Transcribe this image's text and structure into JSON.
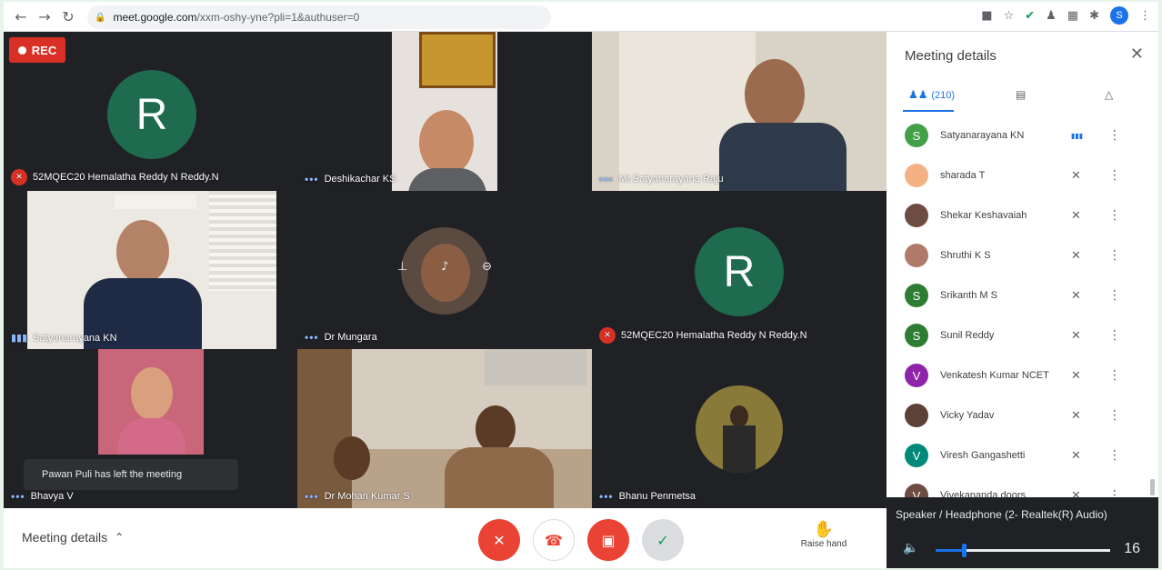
{
  "browser": {
    "url_host": "meet.google.com",
    "url_path": "/xxm-oshy-yne?pli=1&authuser=0",
    "profile_initial": "S"
  },
  "recording": {
    "label": "REC"
  },
  "tiles": [
    {
      "name": "52MQEC20 Hemalatha Reddy N Reddy.N",
      "avatar_letter": "R"
    },
    {
      "name": "Deshikachar KS"
    },
    {
      "name": "Mr.Satyanarayana Raju"
    },
    {
      "name": "Satyanarayana KN"
    },
    {
      "name": "Dr Mungara"
    },
    {
      "name": "52MQEC20 Hemalatha Reddy N Reddy.N",
      "avatar_letter": "R"
    },
    {
      "name": "Bhavya V"
    },
    {
      "name": "Dr Mohan Kumar S"
    },
    {
      "name": "Bhanu Penmetsa"
    }
  ],
  "toast": {
    "text": "Pawan Puli has left the meeting"
  },
  "bottom_bar": {
    "meeting_details_label": "Meeting details",
    "raise_hand_label": "Raise hand"
  },
  "panel": {
    "title": "Meeting details",
    "people_count": "(210)",
    "participants": [
      {
        "name": "Satyanarayana KN",
        "initial": "S",
        "color": "#43a047",
        "speaking": true
      },
      {
        "name": "sharada T",
        "initial": "",
        "color": "#f4b183",
        "speaking": false
      },
      {
        "name": "Shekar Keshavaiah",
        "initial": "",
        "color": "#6d4c41",
        "speaking": false
      },
      {
        "name": "Shruthi K S",
        "initial": "",
        "color": "#b07a6a",
        "speaking": false
      },
      {
        "name": "Srikanth M S",
        "initial": "S",
        "color": "#2e7d32",
        "speaking": false
      },
      {
        "name": "Sunil Reddy",
        "initial": "S",
        "color": "#2e7d32",
        "speaking": false
      },
      {
        "name": "Venkatesh Kumar NCET",
        "initial": "V",
        "color": "#8e24aa",
        "speaking": false
      },
      {
        "name": "Vicky Yadav",
        "initial": "",
        "color": "#5d4037",
        "speaking": false
      },
      {
        "name": "Viresh Gangashetti",
        "initial": "V",
        "color": "#00897b",
        "speaking": false
      },
      {
        "name": "Vivekananda doors",
        "initial": "V",
        "color": "#6d4c41",
        "speaking": false
      }
    ]
  },
  "speaker": {
    "label": "Speaker / Headphone (2- Realtek(R) Audio)",
    "volume": "16",
    "volume_fraction": 0.16
  }
}
